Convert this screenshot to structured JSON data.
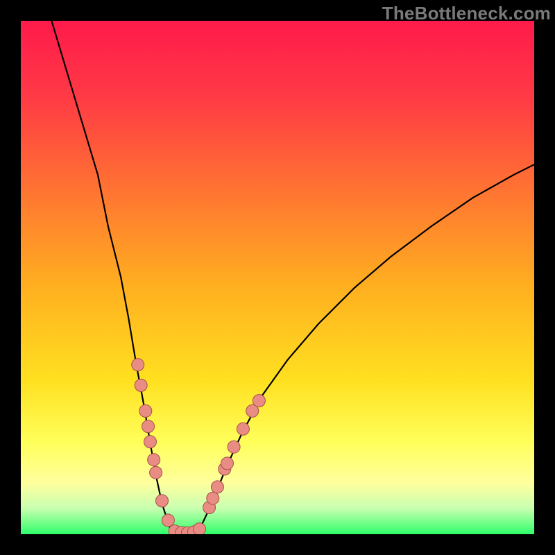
{
  "watermark": "TheBottleneck.com",
  "colors": {
    "frame": "#000000",
    "curve_stroke": "#000000",
    "marker_fill": "#e98c84",
    "marker_stroke": "#a44f48"
  },
  "chart_data": {
    "type": "line",
    "title": "",
    "xlabel": "",
    "ylabel": "",
    "xlim": [
      0,
      100
    ],
    "ylim": [
      0,
      100
    ],
    "curve_points": [
      {
        "x": 6,
        "y": 100
      },
      {
        "x": 9,
        "y": 90
      },
      {
        "x": 12,
        "y": 80
      },
      {
        "x": 15,
        "y": 70
      },
      {
        "x": 17,
        "y": 60
      },
      {
        "x": 19.5,
        "y": 50
      },
      {
        "x": 21,
        "y": 42
      },
      {
        "x": 22.5,
        "y": 33
      },
      {
        "x": 24,
        "y": 25
      },
      {
        "x": 25,
        "y": 19
      },
      {
        "x": 26.2,
        "y": 12
      },
      {
        "x": 27.5,
        "y": 6
      },
      {
        "x": 29,
        "y": 1.3
      },
      {
        "x": 30.5,
        "y": 0.3
      },
      {
        "x": 32,
        "y": 0.2
      },
      {
        "x": 33.5,
        "y": 0.3
      },
      {
        "x": 35,
        "y": 1.3
      },
      {
        "x": 36.5,
        "y": 4.5
      },
      {
        "x": 38,
        "y": 8
      },
      {
        "x": 40,
        "y": 13
      },
      {
        "x": 43,
        "y": 19.5
      },
      {
        "x": 47,
        "y": 27
      },
      {
        "x": 52,
        "y": 34
      },
      {
        "x": 58,
        "y": 41
      },
      {
        "x": 65,
        "y": 48
      },
      {
        "x": 72,
        "y": 54
      },
      {
        "x": 80,
        "y": 60
      },
      {
        "x": 88,
        "y": 65.5
      },
      {
        "x": 96,
        "y": 70
      },
      {
        "x": 100,
        "y": 72
      }
    ],
    "series": [
      {
        "name": "left-branch-markers",
        "points": [
          {
            "x": 22.8,
            "y": 33
          },
          {
            "x": 23.4,
            "y": 29
          },
          {
            "x": 24.3,
            "y": 24
          },
          {
            "x": 24.8,
            "y": 21
          },
          {
            "x": 25.2,
            "y": 18
          },
          {
            "x": 25.9,
            "y": 14.5
          },
          {
            "x": 26.3,
            "y": 12
          },
          {
            "x": 27.5,
            "y": 6.5
          },
          {
            "x": 28.7,
            "y": 2.7
          },
          {
            "x": 30,
            "y": 0.6
          },
          {
            "x": 31.3,
            "y": 0.3
          },
          {
            "x": 32.5,
            "y": 0.25
          },
          {
            "x": 33.7,
            "y": 0.4
          },
          {
            "x": 34.8,
            "y": 1.0
          }
        ]
      },
      {
        "name": "right-branch-markers",
        "points": [
          {
            "x": 36.7,
            "y": 5.2
          },
          {
            "x": 37.4,
            "y": 7.0
          },
          {
            "x": 38.3,
            "y": 9.2
          },
          {
            "x": 39.7,
            "y": 12.7
          },
          {
            "x": 40.2,
            "y": 13.8
          },
          {
            "x": 41.5,
            "y": 17
          },
          {
            "x": 43.3,
            "y": 20.5
          },
          {
            "x": 45.1,
            "y": 24
          },
          {
            "x": 46.4,
            "y": 26
          }
        ]
      }
    ]
  }
}
